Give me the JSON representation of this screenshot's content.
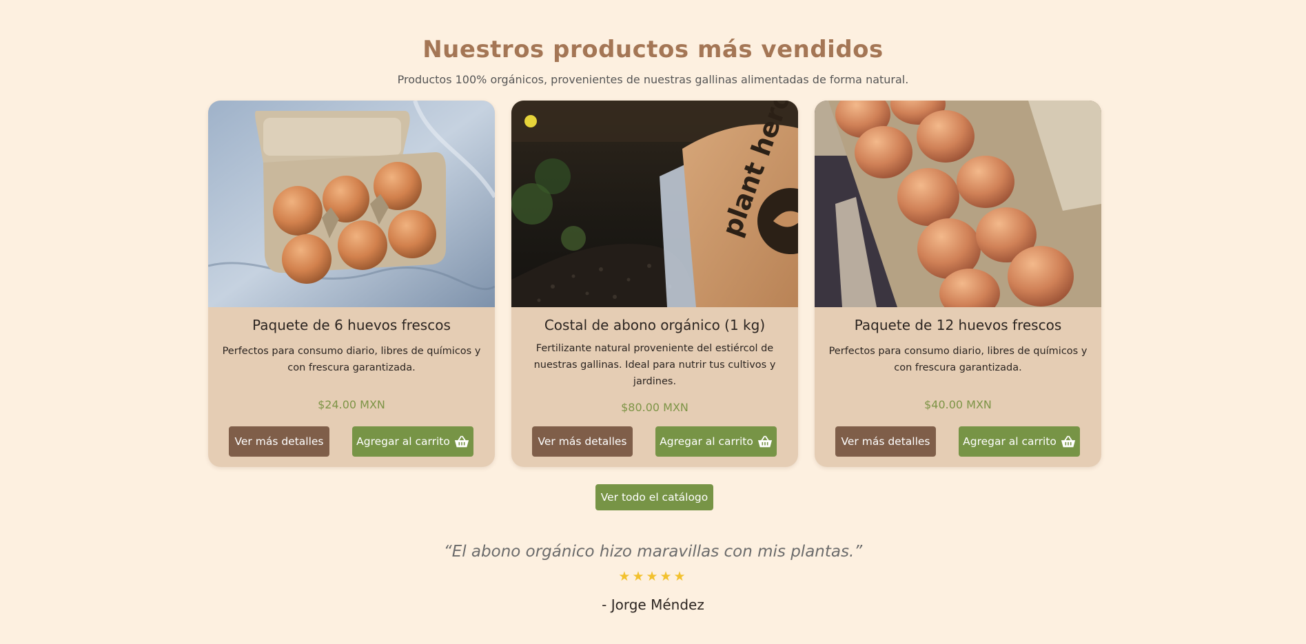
{
  "section": {
    "title": "Nuestros productos más vendidos",
    "subtitle": "Productos 100% orgánicos, provenientes de nuestras gallinas alimentadas de forma natural."
  },
  "products": [
    {
      "title": "Paquete de 6 huevos frescos",
      "description": "Perfectos para consumo diario, libres de químicos y con frescura garantizada.",
      "price": "$24.00 MXN",
      "details_label": "Ver más detalles",
      "cart_label": "Agregar al carrito",
      "image": "egg-carton-6-photo"
    },
    {
      "title": "Costal de abono orgánico (1 kg)",
      "description": "Fertilizante natural proveniente del estiércol de nuestras gallinas. Ideal para nutrir tus cultivos y jardines.",
      "price": "$80.00 MXN",
      "details_label": "Ver más detalles",
      "cart_label": "Agregar al carrito",
      "image": "compost-bag-photo",
      "bag_brand": "plant hero"
    },
    {
      "title": "Paquete de 12 huevos frescos",
      "description": "Perfectos para consumo diario, libres de químicos y con frescura garantizada.",
      "price": "$40.00 MXN",
      "details_label": "Ver más detalles",
      "cart_label": "Agregar al carrito",
      "image": "egg-carton-12-photo"
    }
  ],
  "catalog_button": "Ver todo el catálogo",
  "testimonial": {
    "quote": "“El abono orgánico hizo maravillas con mis plantas.”",
    "rating": 5,
    "stars": "★★★★★",
    "author": "- Jorge Méndez"
  },
  "colors": {
    "background": "#fdf0e0",
    "card": "#e5cdb4",
    "heading": "#a47655",
    "details_button": "#7f5e49",
    "cart_button": "#779446",
    "price": "#7d9446",
    "star": "#f2c12e"
  }
}
